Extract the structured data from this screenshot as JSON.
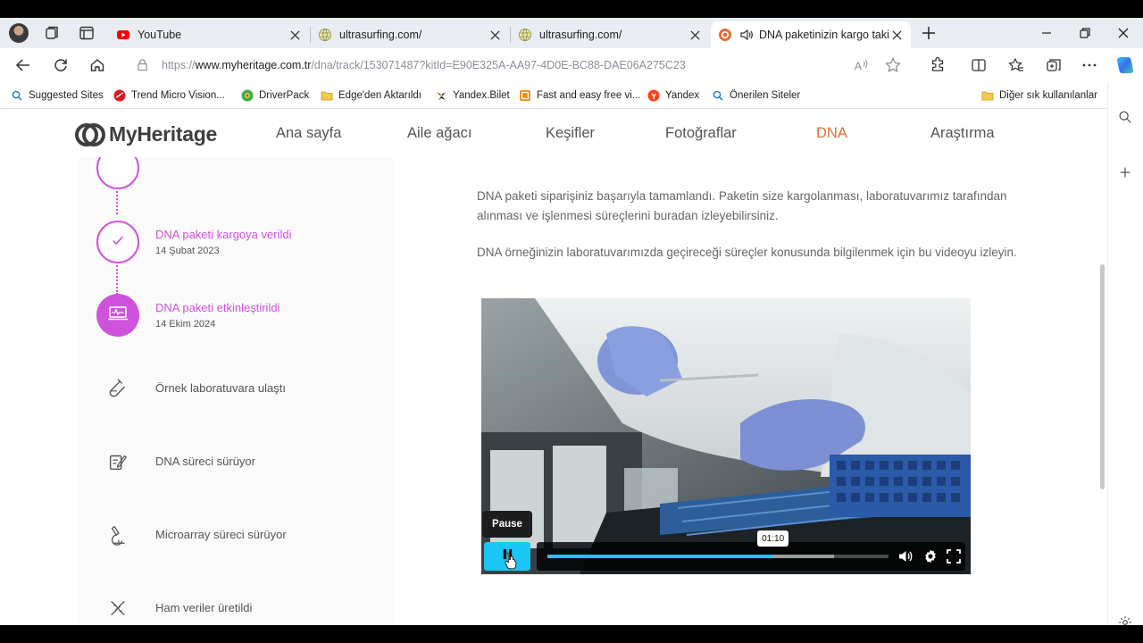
{
  "browser": {
    "tabs": [
      {
        "title": "YouTube",
        "favicon": "youtube-icon",
        "active": false
      },
      {
        "title": "ultrasurfing.com/",
        "favicon": "globe-icon",
        "active": false
      },
      {
        "title": "ultrasurfing.com/",
        "favicon": "globe-icon",
        "active": false
      },
      {
        "title": "DNA paketinizin kargo takibi",
        "favicon": "myheritage-icon",
        "active": true
      }
    ],
    "url": {
      "scheme": "https://",
      "domain": "www.myheritage.com.tr",
      "path": "/dna/track/153071487?kitId=E90E325A-AA97-4D0E-BC88-DAE06A275C23"
    },
    "bookmarks": [
      {
        "label": "Suggested Sites",
        "icon": "search-icon"
      },
      {
        "label": "Trend Micro Vision...",
        "icon": "trend-micro-icon"
      },
      {
        "label": "DriverPack",
        "icon": "driverpack-icon"
      },
      {
        "label": "Edge'den Aktarıldı",
        "icon": "folder-icon"
      },
      {
        "label": "Yandex.Bilet",
        "icon": "yandex-bilet-icon"
      },
      {
        "label": "Fast and easy free vi...",
        "icon": "bookmark-icon"
      },
      {
        "label": "Yandex",
        "icon": "yandex-icon"
      },
      {
        "label": "Önerilen Siteler",
        "icon": "search-icon"
      }
    ],
    "other_bookmarks": "Diğer sık kullanılanlar",
    "colors": {
      "tabstrip": "#e9edf2",
      "accent": "#19c6f5"
    }
  },
  "site": {
    "logo": "MyHeritage",
    "nav": [
      {
        "label": "Ana sayfa",
        "active": false
      },
      {
        "label": "Aile ağacı",
        "active": false
      },
      {
        "label": "Keşifler",
        "active": false
      },
      {
        "label": "Fotoğraflar",
        "active": false
      },
      {
        "label": "DNA",
        "active": true
      },
      {
        "label": "Araştırma",
        "active": false
      }
    ],
    "colors": {
      "nav_active": "#e36e35",
      "step_accent": "#cf52dd",
      "body_text": "#666666"
    }
  },
  "steps": [
    {
      "title": "DNA paketi kargoya verildi",
      "date": "14 Şubat 2023",
      "status": "done",
      "icon": "check-icon"
    },
    {
      "title": "DNA paketi etkinleştirildi",
      "date": "14 Ekim 2024",
      "status": "current",
      "icon": "laptop-pulse-icon"
    },
    {
      "title": "Örnek laboratuvara ulaştı",
      "date": "",
      "status": "pending",
      "icon": "test-tube-icon"
    },
    {
      "title": "DNA süreci sürüyor",
      "date": "",
      "status": "pending",
      "icon": "clipboard-pen-icon"
    },
    {
      "title": "Microarray süreci sürüyor",
      "date": "",
      "status": "pending",
      "icon": "microscope-icon"
    },
    {
      "title": "Ham veriler üretildi",
      "date": "",
      "status": "pending",
      "icon": "dna-icon"
    }
  ],
  "content": {
    "paragraph1": "DNA paketi siparişiniz başarıyla tamamlandı. Paketin size kargolanması, laboratuvarımız tarafından alınması ve işlenmesi süreçlerini buradan izleyebilirsiniz.",
    "paragraph2": "DNA örneğinizin laboratuvarımızda geçireceği süreçler konusunda bilgilenmek için bu videoyu izleyin."
  },
  "video": {
    "tooltip": "Pause",
    "hover_time": "01:10",
    "progress": 0.66,
    "buffered": 0.84,
    "playing": true
  }
}
